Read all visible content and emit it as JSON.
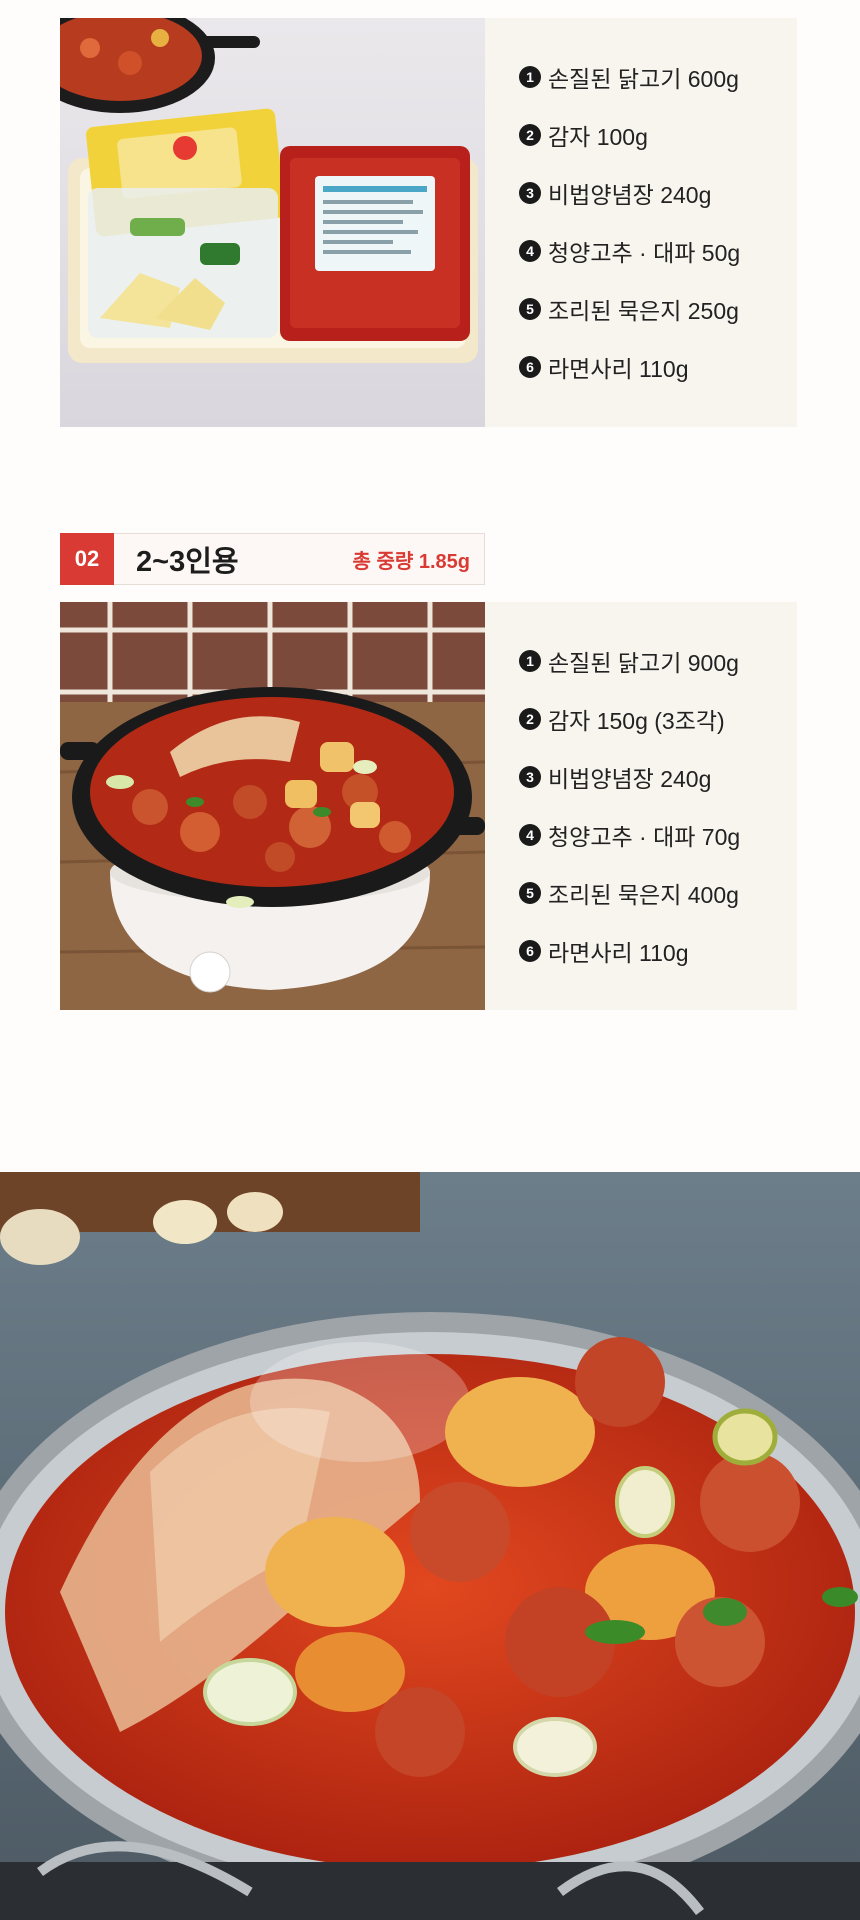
{
  "colors": {
    "accent": "#d93a33",
    "panel": "#f8f4ee",
    "text": "#222222"
  },
  "pack1": {
    "image_alt": "밀키트 구성품 사진",
    "ingredients": [
      {
        "num": "1",
        "text": "손질된 닭고기 600g"
      },
      {
        "num": "2",
        "text": "감자 100g"
      },
      {
        "num": "3",
        "text": "비법양념장 240g"
      },
      {
        "num": "4",
        "text": "청양고추 · 대파 50g"
      },
      {
        "num": "5",
        "text": "조리된 묵은지 250g"
      },
      {
        "num": "6",
        "text": "라면사리 110g"
      }
    ]
  },
  "pack2": {
    "badge": "02",
    "serving": "2~3인용",
    "total_weight": "총 중량 1.85g",
    "ingredients": [
      {
        "num": "1",
        "text": "손질된 닭고기 900g"
      },
      {
        "num": "2",
        "text": "감자 150g (3조각)"
      },
      {
        "num": "3",
        "text": "비법양념장 240g"
      },
      {
        "num": "4",
        "text": "청양고추 · 대파 70g"
      },
      {
        "num": "5",
        "text": "조리된 묵은지 400g"
      },
      {
        "num": "6",
        "text": "라면사리 110g"
      }
    ]
  }
}
